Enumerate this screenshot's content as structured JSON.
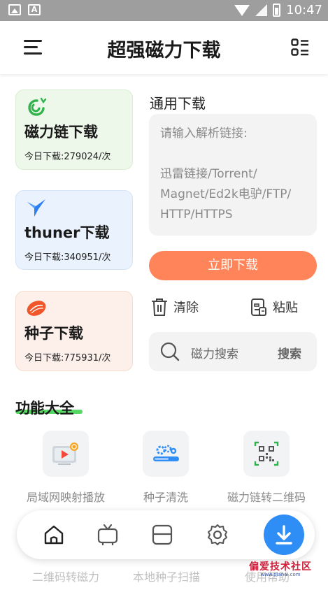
{
  "status_bar": {
    "time": "10:47",
    "icon_a": "A"
  },
  "app": {
    "title": "超强磁力下载"
  },
  "cards": [
    {
      "title": "磁力链下载",
      "count": "今日下载:279024/次"
    },
    {
      "title": "thuner下载",
      "count": "今日下载:340951/次"
    },
    {
      "title": "种子下载",
      "count": "今日下载:775931/次"
    }
  ],
  "general": {
    "title": "通用下载",
    "placeholder": "请输入解析链接:\n\n迅雷链接/Torrent/\nMagnet/Ed2k电驴/FTP/\nHTTP/HTTPS",
    "download_button": "立即下载",
    "clear_label": "清除",
    "paste_label": "粘贴"
  },
  "search": {
    "placeholder": "磁力搜索",
    "button": "搜索"
  },
  "features": {
    "title": "功能大全",
    "items": [
      {
        "label": "局域网映射播放"
      },
      {
        "label": "种子清洗"
      },
      {
        "label": "磁力链转二维码"
      }
    ],
    "peek": [
      "二维码转磁力",
      "本地种子扫描",
      "使用帮助"
    ]
  },
  "watermark": {
    "line1": "偏爱技术社区",
    "line2": "www.pianai.com"
  },
  "colors": {
    "accent_orange": "#ff8459",
    "fab_blue": "#2f8ef5",
    "highlight_green": "#3ad04a"
  }
}
